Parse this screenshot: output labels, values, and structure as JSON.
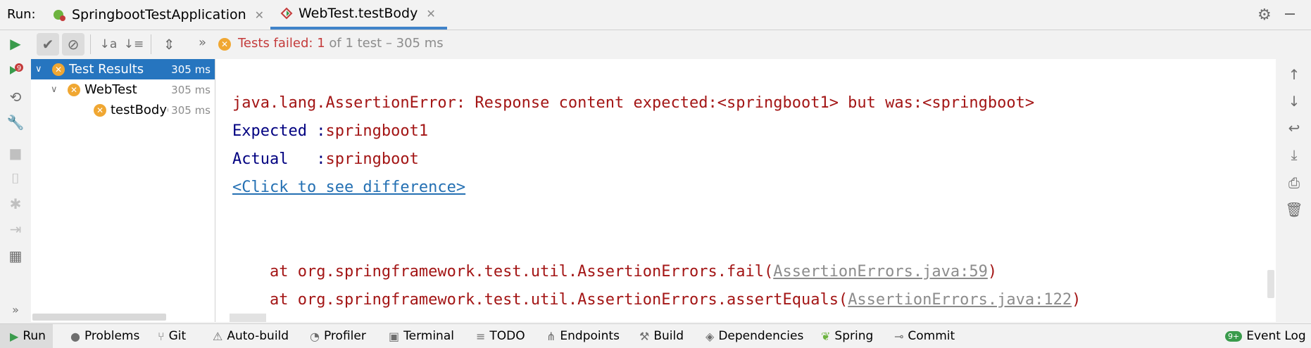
{
  "tabbar": {
    "run_label": "Run:",
    "tabs": [
      {
        "label": "SpringbootTestApplication",
        "close": "✕"
      },
      {
        "label": "WebTest.testBody",
        "close": "✕"
      }
    ]
  },
  "toolbar": {
    "status_prefix": "Tests failed: 1",
    "status_suffix": " of 1 test – 305 ms",
    "more": "»"
  },
  "tree": {
    "items": [
      {
        "label": "Test Results",
        "time": "305 ms"
      },
      {
        "label": "WebTest",
        "time": "305 ms"
      },
      {
        "label": "testBody(",
        "time": "305 ms"
      }
    ]
  },
  "console": {
    "error_line": "java.lang.AssertionError: Response content expected:<springboot1> but was:<springboot>",
    "expected_label": "Expected :",
    "expected_value": "springboot1",
    "actual_label": "Actual   :",
    "actual_value": "springboot",
    "diff_link": "<Click to see difference>",
    "stack": [
      {
        "prefix": "    at org.springframework.test.util.AssertionErrors.fail(",
        "link": "AssertionErrors.java:59",
        "suffix": ")"
      },
      {
        "prefix": "    at org.springframework.test.util.AssertionErrors.assertEquals(",
        "link": "AssertionErrors.java:122",
        "suffix": ")"
      }
    ]
  },
  "bottombar": {
    "items": [
      "Run",
      "Problems",
      "Git",
      "Auto-build",
      "Profiler",
      "Terminal",
      "TODO",
      "Endpoints",
      "Build",
      "Dependencies",
      "Spring",
      "Commit"
    ],
    "event_log": "Event Log",
    "event_badge": "9+"
  },
  "colors": {
    "accent": "#2675bf",
    "error": "#c43b3b",
    "fail_icon": "#f0a732",
    "run_green": "#3a9b4c"
  }
}
